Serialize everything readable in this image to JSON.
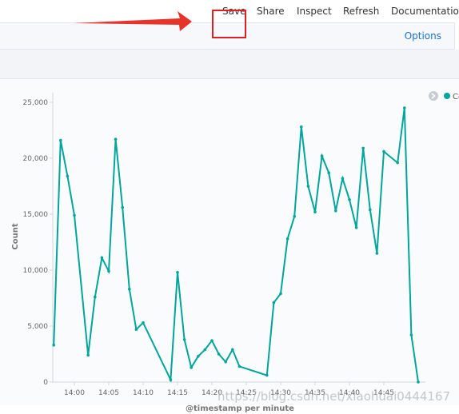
{
  "nav": {
    "items": [
      "Save",
      "Share",
      "Inspect",
      "Refresh",
      "Documentation"
    ]
  },
  "panel": {
    "options_label": "Options"
  },
  "legend": {
    "label": "Co",
    "color": "#00a69b"
  },
  "chart_data": {
    "type": "line",
    "xlabel": "@timestamp per minute",
    "ylabel": "Count",
    "ylim": [
      0,
      25000
    ],
    "yticks": [
      "0",
      "5,000",
      "10,000",
      "15,000",
      "20,000",
      "25,000"
    ],
    "xticks": [
      "14:00",
      "14:05",
      "14:10",
      "14:15",
      "14:20",
      "14:25",
      "14:30",
      "14:35",
      "14:40",
      "14:45"
    ],
    "line_color": "#00a69b",
    "grid": false,
    "legend_position": "top-right",
    "series": [
      {
        "name": "Co",
        "points": [
          [
            "13:57",
            3300
          ],
          [
            "13:58",
            21600
          ],
          [
            "13:59",
            18400
          ],
          [
            "14:00",
            14900
          ],
          [
            "14:02",
            2400
          ],
          [
            "14:03",
            7600
          ],
          [
            "14:04",
            11100
          ],
          [
            "14:05",
            9900
          ],
          [
            "14:06",
            21700
          ],
          [
            "14:07",
            15600
          ],
          [
            "14:08",
            8300
          ],
          [
            "14:09",
            4700
          ],
          [
            "14:10",
            5300
          ],
          [
            "14:14",
            200
          ],
          [
            "14:15",
            9800
          ],
          [
            "14:16",
            3800
          ],
          [
            "14:17",
            1300
          ],
          [
            "14:18",
            2300
          ],
          [
            "14:19",
            2900
          ],
          [
            "14:20",
            3700
          ],
          [
            "14:21",
            2500
          ],
          [
            "14:22",
            1800
          ],
          [
            "14:23",
            2900
          ],
          [
            "14:24",
            1400
          ],
          [
            "14:28",
            600
          ],
          [
            "14:29",
            7100
          ],
          [
            "14:30",
            7900
          ],
          [
            "14:31",
            12800
          ],
          [
            "14:32",
            14800
          ],
          [
            "14:33",
            22800
          ],
          [
            "14:34",
            17500
          ],
          [
            "14:35",
            15200
          ],
          [
            "14:36",
            20200
          ],
          [
            "14:37",
            18700
          ],
          [
            "14:38",
            15300
          ],
          [
            "14:39",
            18200
          ],
          [
            "14:40",
            16300
          ],
          [
            "14:41",
            13800
          ],
          [
            "14:42",
            20900
          ],
          [
            "14:43",
            15400
          ],
          [
            "14:44",
            11500
          ],
          [
            "14:45",
            20600
          ],
          [
            "14:47",
            19600
          ],
          [
            "14:48",
            24500
          ],
          [
            "14:49",
            4200
          ],
          [
            "14:50",
            0
          ]
        ]
      }
    ]
  },
  "watermark": "https://blog.csdn.net/xiaohuai0444167"
}
